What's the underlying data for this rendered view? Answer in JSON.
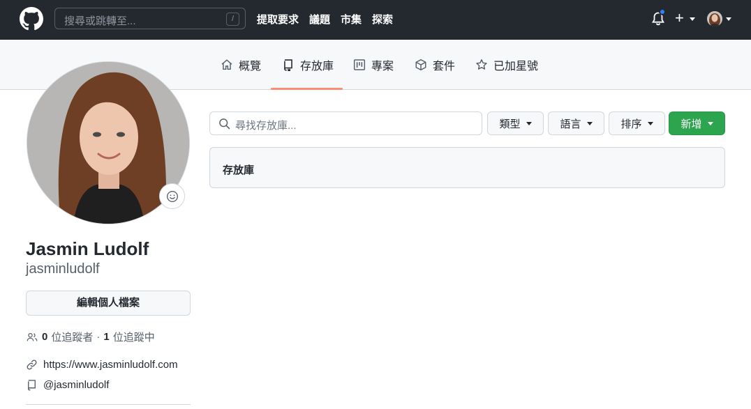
{
  "header": {
    "search_placeholder": "搜尋或跳轉至...",
    "slash_key": "/",
    "nav": [
      "提取要求",
      "議題",
      "市集",
      "探索"
    ],
    "plus_label": "+"
  },
  "tabs": [
    {
      "label": "概覽",
      "icon": "home-icon"
    },
    {
      "label": "存放庫",
      "icon": "repo-icon",
      "selected": true
    },
    {
      "label": "專案",
      "icon": "project-icon"
    },
    {
      "label": "套件",
      "icon": "package-icon"
    },
    {
      "label": "已加星號",
      "icon": "star-icon"
    }
  ],
  "profile": {
    "full_name": "Jasmin Ludolf",
    "username": "jasminludolf",
    "edit_button": "編輯個人檔案",
    "followers_count": "0",
    "followers_label": "位追蹤者",
    "separator": "·",
    "following_count": "1",
    "following_label": "位追蹤中",
    "website": "https://www.jasminludolf.com",
    "twitter": "@jasminludolf"
  },
  "repos": {
    "search_placeholder": "尋找存放庫...",
    "type_label": "類型",
    "language_label": "語言",
    "sort_label": "排序",
    "new_label": "新增",
    "box_title": "存放庫"
  },
  "colors": {
    "header_bg": "#24292f",
    "tab_underline": "#fd8c73",
    "new_button": "#2da44e",
    "notification_dot": "#2f81f7"
  }
}
